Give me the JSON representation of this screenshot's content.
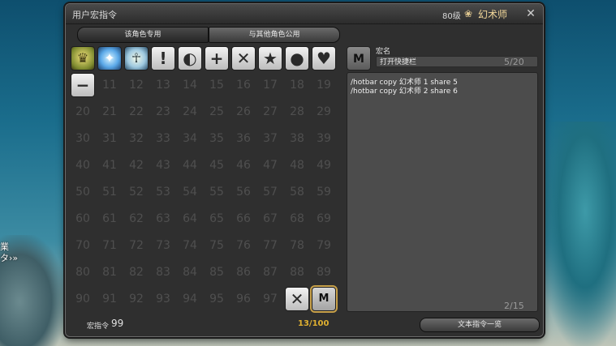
{
  "background": {
    "side_text_1": "業",
    "side_text_2": "タ›»"
  },
  "window": {
    "title": "用户宏指令",
    "level": "80级",
    "job_icon": "conjurer-icon",
    "job_name": "幻术师",
    "close_icon": "close-icon"
  },
  "tabs": [
    {
      "label": "该角色专用"
    },
    {
      "label": "与其他角色公用"
    }
  ],
  "grid": {
    "icon_slots": [
      {
        "name": "gold-crown-icon",
        "glyph": "♛"
      },
      {
        "name": "blue-sparkle-icon",
        "glyph": "✦"
      },
      {
        "name": "person-pose-icon",
        "glyph": "☥"
      },
      {
        "name": "exclamation-icon",
        "glyph": "!"
      },
      {
        "name": "lightbulb-icon",
        "glyph": "◐"
      },
      {
        "name": "plus-icon",
        "glyph": "+"
      },
      {
        "name": "cross-icon",
        "glyph": "✕"
      },
      {
        "name": "star-icon",
        "glyph": "★"
      },
      {
        "name": "circle-icon",
        "glyph": "●"
      },
      {
        "name": "heart-icon",
        "glyph": "♥"
      },
      {
        "name": "minus-icon",
        "glyph": "−"
      }
    ],
    "numbers": [
      "11",
      "12",
      "13",
      "14",
      "15",
      "16",
      "17",
      "18",
      "19",
      "20",
      "21",
      "22",
      "23",
      "24",
      "25",
      "26",
      "27",
      "28",
      "29",
      "30",
      "31",
      "32",
      "33",
      "34",
      "35",
      "36",
      "37",
      "38",
      "39",
      "40",
      "41",
      "42",
      "43",
      "44",
      "45",
      "46",
      "47",
      "48",
      "49",
      "50",
      "51",
      "52",
      "53",
      "54",
      "55",
      "56",
      "57",
      "58",
      "59",
      "60",
      "61",
      "62",
      "63",
      "64",
      "65",
      "66",
      "67",
      "68",
      "69",
      "70",
      "71",
      "72",
      "73",
      "74",
      "75",
      "76",
      "77",
      "78",
      "79",
      "80",
      "81",
      "82",
      "83",
      "84",
      "85",
      "86",
      "87",
      "88",
      "89",
      "90",
      "91",
      "92",
      "93",
      "94",
      "95",
      "96",
      "97"
    ],
    "tail_slots": [
      {
        "name": "cross-icon",
        "glyph": "✕"
      },
      {
        "name": "m-icon",
        "glyph": "M"
      }
    ]
  },
  "editor": {
    "macro_icon": "M",
    "name_label": "宏名",
    "name_value": "打开快捷栏",
    "name_count": "5/20",
    "lines": [
      "/hotbar copy 幻术师 1 share 5",
      "/hotbar copy 幻术师 2 share 6"
    ],
    "line_count": "2/15"
  },
  "footer": {
    "macro_count_label": "宏指令",
    "macro_count_value": "99",
    "used_count": "13/100",
    "command_list_button": "文本指令一览"
  }
}
